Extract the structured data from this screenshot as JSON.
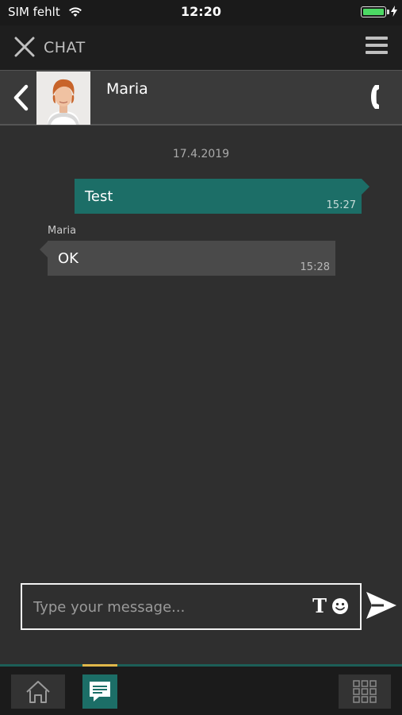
{
  "status_bar": {
    "carrier": "SIM fehlt",
    "time": "12:20",
    "battery_level": 1.0
  },
  "top_bar": {
    "title": "CHAT"
  },
  "contact": {
    "name": "Maria"
  },
  "conversation": {
    "date": "17.4.2019",
    "messages": [
      {
        "direction": "outgoing",
        "text": "Test",
        "time": "15:27"
      },
      {
        "direction": "incoming",
        "sender": "Maria",
        "text": "OK",
        "time": "15:28"
      }
    ]
  },
  "compose": {
    "placeholder": "Type your message...",
    "value": "",
    "format_label": "T"
  },
  "colors": {
    "accent": "#1c6e67",
    "background": "#2f2f2f",
    "incoming_bubble": "#4a4a4a",
    "active_indicator": "#e0b84a"
  },
  "icons": [
    "wifi-icon",
    "battery-icon",
    "close-icon",
    "menu-icon",
    "back-icon",
    "phone-icon",
    "emoji-icon",
    "send-icon",
    "home-icon",
    "chat-icon",
    "grid-icon"
  ],
  "bottom_nav": {
    "active": "chat"
  }
}
